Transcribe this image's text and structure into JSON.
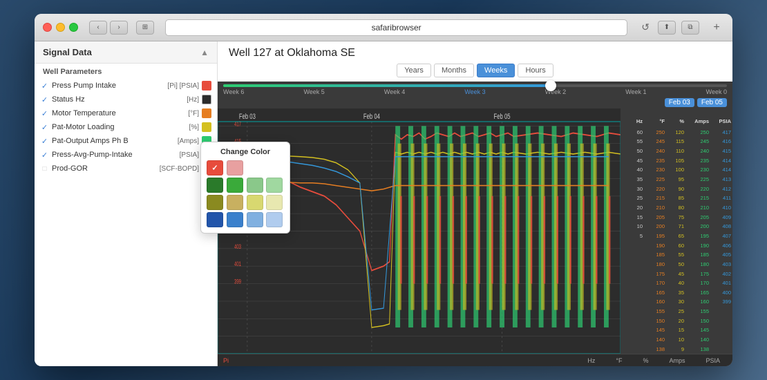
{
  "browser": {
    "url": "safaribrowser",
    "back_label": "‹",
    "forward_label": "›",
    "sidebar_label": "⊞",
    "reload_label": "↺",
    "share_label": "⬆",
    "tabs_label": "⧉",
    "new_tab_label": "+"
  },
  "sidebar": {
    "title": "Signal Data",
    "section_title": "Well Parameters",
    "chevron": "▲",
    "parameters": [
      {
        "checked": true,
        "name": "Press Pump Intake",
        "unit": "[Pi] [PSIA]",
        "color": "#e74c3c",
        "color_name": "red"
      },
      {
        "checked": true,
        "name": "Status Hz",
        "unit": "[Hz]",
        "color": "#2c2c2c",
        "color_name": "dark"
      },
      {
        "checked": true,
        "name": "Motor Temperature",
        "unit": "[°F]",
        "color": "#e67e22",
        "color_name": "orange"
      },
      {
        "checked": true,
        "name": "Pat-Motor Loading",
        "unit": "[%]",
        "color": "#f1c40f",
        "color_name": "yellow"
      },
      {
        "checked": true,
        "name": "Pat-Output Amps Ph B",
        "unit": "[Amps]",
        "color": "#2ecc71",
        "color_name": "green"
      },
      {
        "checked": true,
        "name": "Press-Avg-Pump-Intake",
        "unit": "[PSIA]",
        "color": "#3498db",
        "color_name": "blue"
      },
      {
        "checked": false,
        "name": "Prod-GOR",
        "unit": "[SCF-BOPD]",
        "color": "#3498db",
        "color_name": "blue-light"
      }
    ]
  },
  "color_picker": {
    "title": "Change Color",
    "swatches": [
      "#e74c3c",
      "#e8a0a0",
      "#2ecc71",
      "#a0d8a0",
      "#b8860b",
      "#d4b860",
      "#d4d470",
      "#e8e8a0",
      "#3498db",
      "#a0c4e8"
    ],
    "selected_index": 0
  },
  "chart": {
    "title": "Well 127 at Oklahoma SE",
    "time_buttons": [
      "Years",
      "Months",
      "Weeks",
      "Hours"
    ],
    "active_time": "Weeks",
    "timeline_weeks": [
      "Week 6",
      "Week 5",
      "Week 4",
      "Week 3",
      "Week 2",
      "Week 1",
      "Week 0"
    ],
    "date_from": "Feb 03",
    "date_to": "Feb 05",
    "date_labels": [
      "Feb 03",
      "Feb 04",
      "Feb 05"
    ],
    "bottom_labels": [
      "Pi",
      "Hz",
      "°F",
      "%",
      "Amps",
      "PSIA"
    ],
    "y_right_labels": {
      "hz": [
        "417",
        "416",
        "415",
        "414",
        "414",
        "413",
        "412",
        "411",
        "410",
        "409",
        "408",
        "407",
        "406",
        "405",
        "403",
        "402",
        "401",
        "399"
      ],
      "psia": [
        "60",
        "55",
        "50",
        "45",
        "40",
        "35",
        "30",
        "25",
        "20",
        "15",
        "10",
        "5"
      ],
      "amps": [
        "250",
        "245",
        "240",
        "235",
        "230",
        "225",
        "220",
        "215",
        "210",
        "205",
        "200",
        "195",
        "190",
        "185",
        "180",
        "175",
        "170",
        "165",
        "160",
        "155",
        "150",
        "145",
        "140",
        "138"
      ],
      "pct": [
        "120",
        "115",
        "110",
        "105",
        "100",
        "95",
        "90",
        "85",
        "80",
        "75",
        "71",
        "65",
        "60",
        "55",
        "50",
        "45",
        "40",
        "35",
        "30",
        "25",
        "20",
        "15",
        "10",
        "9"
      ]
    }
  }
}
